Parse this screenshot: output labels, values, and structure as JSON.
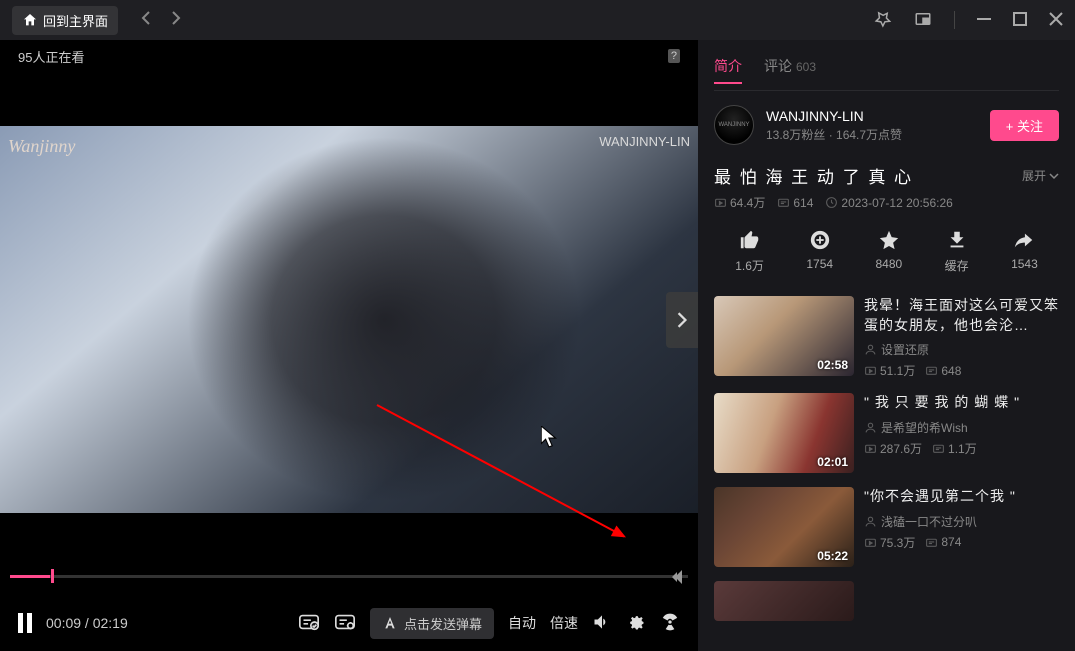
{
  "titlebar": {
    "back_main": "回到主界面"
  },
  "player": {
    "viewers": "95人正在看",
    "watermark_left": "Wanjinny",
    "watermark_right": "WANJINNY-LIN",
    "time_current": "00:09",
    "time_total": "02:19",
    "danmu_placeholder": "点击发送弹幕",
    "auto": "自动",
    "speed": "倍速"
  },
  "sidebar": {
    "tabs": {
      "intro": "简介",
      "comments": "评论",
      "comments_count": "603"
    },
    "uploader": {
      "name": "WANJINNY-LIN",
      "stats": "13.8万粉丝 · 164.7万点赞",
      "follow": "+ 关注"
    },
    "video": {
      "title": "最 怕 海 王 动 了 真 心",
      "expand": "展开",
      "plays": "64.4万",
      "danmu": "614",
      "date": "2023-07-12 20:56:26"
    },
    "actions": {
      "like": "1.6万",
      "coin": "1754",
      "fav": "8480",
      "cache": "缓存",
      "share": "1543"
    },
    "recs": [
      {
        "title": "我晕！海王面对这么可爱又笨蛋的女朋友，他也会沦…",
        "uploader": "设置还原",
        "plays": "51.1万",
        "danmu": "648",
        "duration": "02:58",
        "bg": "linear-gradient(135deg,#d8c8b8 0%,#b89878 40%,#2a2530 100%)"
      },
      {
        "title": "\" 我 只 要 我 的 蝴 蝶 \"",
        "uploader": "是希望的希Wish",
        "plays": "287.6万",
        "danmu": "1.1万",
        "duration": "02:01",
        "bg": "linear-gradient(110deg,#e8dcc8 0%, #c8a080 40%, #8a3530 70%, #3a2020 100%)"
      },
      {
        "title": "\"你不会遇见第二个我 \"",
        "uploader": "浅磕一口不过分叭",
        "plays": "75.3万",
        "danmu": "874",
        "duration": "05:22",
        "bg": "linear-gradient(135deg,#4a3528 0%, #6a4535 30%, #8a5a3a 60%, #2a2018 100%)"
      }
    ]
  }
}
